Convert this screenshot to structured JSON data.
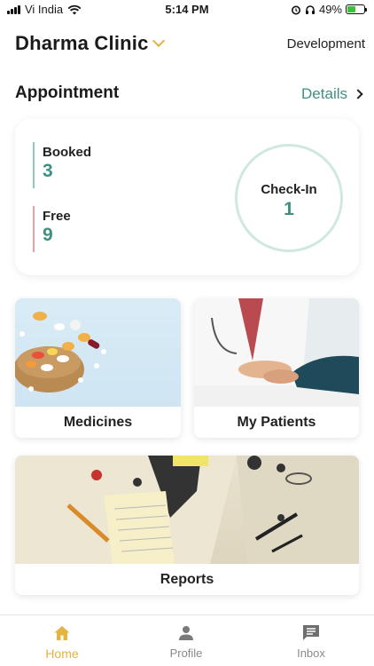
{
  "status_bar": {
    "carrier": "Vi India",
    "time": "5:14 PM",
    "battery_percent": "49%",
    "battery_level": 0.49
  },
  "header": {
    "clinic_name": "Dharma Clinic",
    "environment": "Development"
  },
  "appointment": {
    "title": "Appointment",
    "details_label": "Details",
    "booked_label": "Booked",
    "booked_value": "3",
    "free_label": "Free",
    "free_value": "9",
    "checkin_label": "Check-In",
    "checkin_value": "1"
  },
  "tiles": {
    "medicines": "Medicines",
    "patients": "My Patients",
    "reports": "Reports"
  },
  "tabbar": {
    "home": "Home",
    "profile": "Profile",
    "inbox": "Inbox"
  },
  "colors": {
    "accent_teal": "#3f8f83",
    "accent_gold": "#e2b542",
    "booked_bar": "#8fc9b6",
    "free_bar": "#e8a0a0",
    "battery_green": "#3cc13b"
  },
  "icons": {
    "status": [
      "signal-icon",
      "wifi-icon",
      "alarm-icon",
      "headphones-icon",
      "battery-icon"
    ],
    "tabs": [
      "home-icon",
      "person-icon",
      "chat-icon"
    ]
  }
}
